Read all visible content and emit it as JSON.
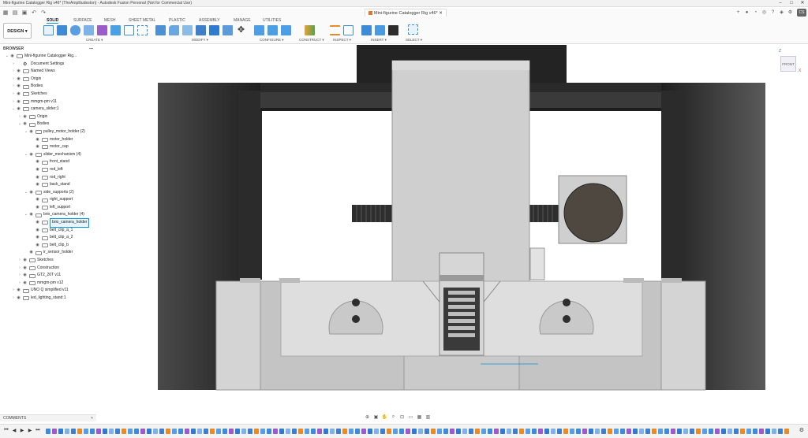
{
  "window": {
    "title": "Mini-figurine Catalogger Rig v46* (TheAmplitudeston) - Autodesk Fusion Personal (Not for Commercial Use)",
    "doc_tab": "Mini-figurine Catalogger Rig v46*",
    "user_initials": "CS"
  },
  "ribbon": {
    "workspace": "DESIGN",
    "tabs": [
      "SOLID",
      "SURFACE",
      "MESH",
      "SHEET METAL",
      "PLASTIC",
      "ASSEMBLY",
      "MANAGE",
      "UTILITIES"
    ],
    "groups": [
      "CREATE",
      "MODIFY",
      "CONFIGURE",
      "CONSTRUCT",
      "INSPECT",
      "INSERT",
      "SELECT"
    ]
  },
  "browser": {
    "header": "BROWSER",
    "rows": [
      {
        "label": "Mini-figurine Catalogger Rig...",
        "depth": 0,
        "exp": "v",
        "type": "doc"
      },
      {
        "label": "Document Settings",
        "depth": 1,
        "exp": ">",
        "type": "gear"
      },
      {
        "label": "Named Views",
        "depth": 1,
        "exp": ">",
        "type": "folder"
      },
      {
        "label": "Origin",
        "depth": 1,
        "exp": ">",
        "type": "folder"
      },
      {
        "label": "Bodies",
        "depth": 1,
        "exp": ">",
        "type": "folder"
      },
      {
        "label": "Sketches",
        "depth": 1,
        "exp": ">",
        "type": "folder"
      },
      {
        "label": "mmgm-pm v11",
        "depth": 1,
        "exp": ">",
        "type": "link"
      },
      {
        "label": "camera_slider:1",
        "depth": 1,
        "exp": "v",
        "type": "comp"
      },
      {
        "label": "Origin",
        "depth": 2,
        "exp": ">",
        "type": "folder"
      },
      {
        "label": "Bodies",
        "depth": 2,
        "exp": "v",
        "type": "folder"
      },
      {
        "label": "pulley_motor_holder (2)",
        "depth": 3,
        "exp": "v",
        "type": "folder"
      },
      {
        "label": "motor_holder",
        "depth": 4,
        "exp": "",
        "type": "body"
      },
      {
        "label": "motor_cap",
        "depth": 4,
        "exp": "",
        "type": "body"
      },
      {
        "label": "slider_mechanism (4)",
        "depth": 3,
        "exp": "v",
        "type": "folder"
      },
      {
        "label": "front_stand",
        "depth": 4,
        "exp": "",
        "type": "body"
      },
      {
        "label": "rod_left",
        "depth": 4,
        "exp": "",
        "type": "body"
      },
      {
        "label": "rod_right",
        "depth": 4,
        "exp": "",
        "type": "body"
      },
      {
        "label": "back_stand",
        "depth": 4,
        "exp": "",
        "type": "body"
      },
      {
        "label": "side_supports (2)",
        "depth": 3,
        "exp": "v",
        "type": "folder"
      },
      {
        "label": "right_support",
        "depth": 4,
        "exp": "",
        "type": "body"
      },
      {
        "label": "left_support",
        "depth": 4,
        "exp": "",
        "type": "body"
      },
      {
        "label": "brio_camera_holder (4)",
        "depth": 3,
        "exp": "v",
        "type": "folder"
      },
      {
        "label": "brio_camera_holder",
        "depth": 4,
        "exp": "",
        "type": "body",
        "selected": true
      },
      {
        "label": "belt_clip_a_1",
        "depth": 4,
        "exp": "",
        "type": "body"
      },
      {
        "label": "belt_clip_a_2",
        "depth": 4,
        "exp": "",
        "type": "body"
      },
      {
        "label": "belt_clip_b",
        "depth": 4,
        "exp": "",
        "type": "body"
      },
      {
        "label": "ir_sensor_holder",
        "depth": 3,
        "exp": "",
        "type": "body"
      },
      {
        "label": "Sketches",
        "depth": 2,
        "exp": ">",
        "type": "folder"
      },
      {
        "label": "Construction",
        "depth": 2,
        "exp": ">",
        "type": "folder"
      },
      {
        "label": "GT2_20T v11",
        "depth": 2,
        "exp": ">",
        "type": "link"
      },
      {
        "label": "mmgm-pm v12",
        "depth": 2,
        "exp": ">",
        "type": "link"
      },
      {
        "label": "UNO Q simplified v11",
        "depth": 1,
        "exp": ">",
        "type": "link"
      },
      {
        "label": "led_lighting_stand:1",
        "depth": 1,
        "exp": ">",
        "type": "comp"
      }
    ]
  },
  "comments": {
    "label": "COMMENTS"
  },
  "viewcube": {
    "face": "FRONT",
    "axis_z": "Z",
    "axis_x": "X"
  },
  "colors": {
    "accent": "#0696d7",
    "frame": "#232323",
    "body_light": "#cfcfcf",
    "body_mid": "#b9b9b9",
    "motor": "#4e4840"
  }
}
